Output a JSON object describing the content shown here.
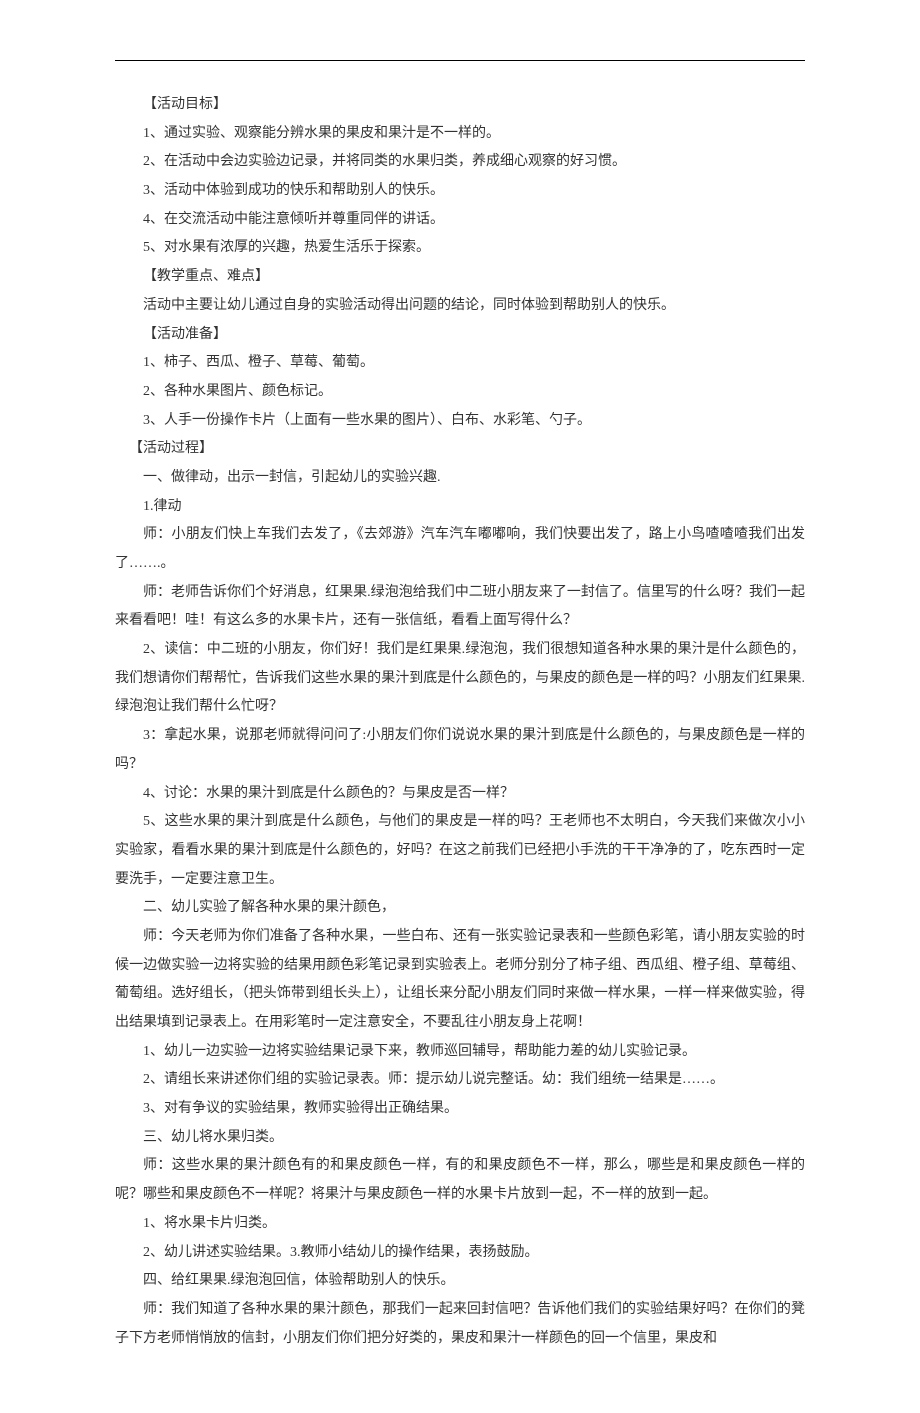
{
  "lines": [
    {
      "cls": "indent",
      "text": "【活动目标】"
    },
    {
      "cls": "indent",
      "text": "1、通过实验、观察能分辨水果的果皮和果汁是不一样的。"
    },
    {
      "cls": "indent",
      "text": "2、在活动中会边实验边记录，并将同类的水果归类，养成细心观察的好习惯。"
    },
    {
      "cls": "indent",
      "text": "3、活动中体验到成功的快乐和帮助别人的快乐。"
    },
    {
      "cls": "indent",
      "text": "4、在交流活动中能注意倾听并尊重同伴的讲话。"
    },
    {
      "cls": "indent",
      "text": "5、对水果有浓厚的兴趣，热爱生活乐于探索。"
    },
    {
      "cls": "indent",
      "text": "【教学重点、难点】"
    },
    {
      "cls": "indent",
      "text": "活动中主要让幼儿通过自身的实验活动得出问题的结论，同时体验到帮助别人的快乐。"
    },
    {
      "cls": "indent",
      "text": "【活动准备】"
    },
    {
      "cls": "indent",
      "text": "1、柿子、西瓜、橙子、草莓、葡萄。"
    },
    {
      "cls": "indent",
      "text": "2、各种水果图片、颜色标记。"
    },
    {
      "cls": "indent",
      "text": "3、人手一份操作卡片（上面有一些水果的图片）、白布、水彩笔、勺子。"
    },
    {
      "cls": "indent1",
      "text": "【活动过程】"
    },
    {
      "cls": "indent",
      "text": "一、做律动，出示一封信，引起幼儿的实验兴趣."
    },
    {
      "cls": "indent",
      "text": "1.律动"
    },
    {
      "cls": "indent",
      "text": "师：小朋友们快上车我们去发了，《去郊游》汽车汽车嘟嘟响，我们快要出发了，路上小鸟喳喳喳我们出发了…….。"
    },
    {
      "cls": "indent",
      "text": "师：老师告诉你们个好消息，红果果.绿泡泡给我们中二班小朋友来了一封信了。信里写的什么呀？我们一起来看看吧！哇！有这么多的水果卡片，还有一张信纸，看看上面写得什么？"
    },
    {
      "cls": "indent",
      "text": "2、读信：中二班的小朋友，你们好！我们是红果果.绿泡泡，我们很想知道各种水果的果汁是什么颜色的，我们想请你们帮帮忙，告诉我们这些水果的果汁到底是什么颜色的，与果皮的颜色是一样的吗？小朋友们红果果.绿泡泡让我们帮什么忙呀？"
    },
    {
      "cls": "indent",
      "text": "3：拿起水果，说那老师就得问问了:小朋友们你们说说水果的果汁到底是什么颜色的，与果皮颜色是一样的吗？"
    },
    {
      "cls": "indent",
      "text": "4、讨论：水果的果汁到底是什么颜色的？与果皮是否一样？"
    },
    {
      "cls": "indent",
      "text": "5、这些水果的果汁到底是什么颜色，与他们的果皮是一样的吗？王老师也不太明白，今天我们来做次小小实验家，看看水果的果汁到底是什么颜色的，好吗？在这之前我们已经把小手洗的干干净净的了，吃东西时一定要洗手，一定要注意卫生。"
    },
    {
      "cls": "indent",
      "text": "二、幼儿实验了解各种水果的果汁颜色，"
    },
    {
      "cls": "indent",
      "text": "师：今天老师为你们准备了各种水果，一些白布、还有一张实验记录表和一些颜色彩笔，请小朋友实验的时候一边做实验一边将实验的结果用颜色彩笔记录到实验表上。老师分别分了柿子组、西瓜组、橙子组、草莓组、葡萄组。选好组长，（把头饰带到组长头上），让组长来分配小朋友们同时来做一样水果，一样一样来做实验，得出结果填到记录表上。在用彩笔时一定注意安全，不要乱往小朋友身上花啊！"
    },
    {
      "cls": "indent",
      "text": "1、幼儿一边实验一边将实验结果记录下来，教师巡回辅导，帮助能力差的幼儿实验记录。"
    },
    {
      "cls": "indent",
      "text": "2、请组长来讲述你们组的实验记录表。师：提示幼儿说完整话。幼：我们组统一结果是……。"
    },
    {
      "cls": "indent",
      "text": "3、对有争议的实验结果，教师实验得出正确结果。"
    },
    {
      "cls": "indent",
      "text": "三、幼儿将水果归类。"
    },
    {
      "cls": "indent",
      "text": "师：这些水果的果汁颜色有的和果皮颜色一样，有的和果皮颜色不一样，那么，哪些是和果皮颜色一样的呢？哪些和果皮颜色不一样呢？将果汁与果皮颜色一样的水果卡片放到一起，不一样的放到一起。"
    },
    {
      "cls": "indent",
      "text": "1、将水果卡片归类。"
    },
    {
      "cls": "indent",
      "text": "2、幼儿讲述实验结果。3.教师小结幼儿的操作结果，表扬鼓励。"
    },
    {
      "cls": "indent",
      "text": "四、给红果果.绿泡泡回信，体验帮助别人的快乐。"
    },
    {
      "cls": "indent",
      "text": "师：我们知道了各种水果的果汁颜色，那我们一起来回封信吧？告诉他们我们的实验结果好吗？在你们的凳子下方老师悄悄放的信封，小朋友们你们把分好类的，果皮和果汁一样颜色的回一个信里，果皮和"
    }
  ]
}
